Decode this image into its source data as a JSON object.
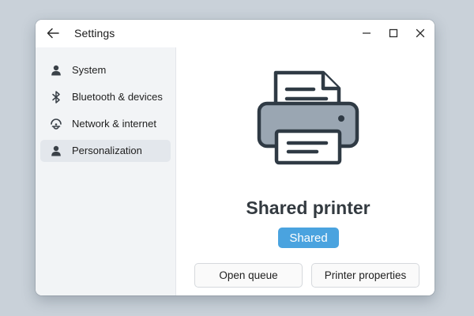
{
  "window": {
    "title": "Settings"
  },
  "sidebar": {
    "items": [
      {
        "label": "System",
        "icon": "person-icon",
        "active": false
      },
      {
        "label": "Bluetooth & devices",
        "icon": "bluetooth-icon",
        "active": false
      },
      {
        "label": "Network & internet",
        "icon": "network-icon",
        "active": false
      },
      {
        "label": "Personalization",
        "icon": "person-icon",
        "active": true
      }
    ]
  },
  "main": {
    "device_icon": "printer-icon",
    "device_name": "Shared printer",
    "status_badge": "Shared",
    "actions": {
      "open_queue": "Open queue",
      "printer_properties": "Printer properties"
    }
  },
  "colors": {
    "accent": "#4aa3df",
    "printer_body": "#9aa6b2",
    "printer_outline": "#2f3a44",
    "sidebar_bg": "#f2f4f6",
    "active_item_bg": "#e3e7ec",
    "desktop_bg": "#c9d1d9"
  }
}
